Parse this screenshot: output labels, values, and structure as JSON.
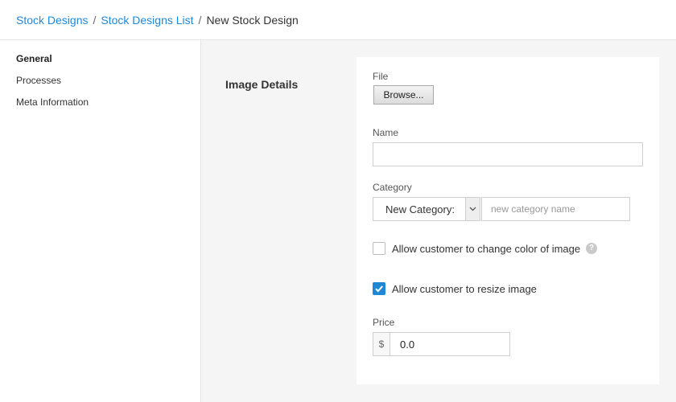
{
  "breadcrumb": {
    "items": [
      "Stock Designs",
      "Stock Designs List"
    ],
    "current": "New Stock Design",
    "separator": "/"
  },
  "sidebar": {
    "items": [
      {
        "label": "General",
        "active": true
      },
      {
        "label": "Processes",
        "active": false
      },
      {
        "label": "Meta Information",
        "active": false
      }
    ]
  },
  "section": {
    "title": "Image Details"
  },
  "form": {
    "file": {
      "label": "File",
      "button": "Browse..."
    },
    "name": {
      "label": "Name",
      "value": ""
    },
    "category": {
      "label": "Category",
      "selected": "New Category:",
      "placeholder": "new category name",
      "value": ""
    },
    "allow_color": {
      "label": "Allow customer to change color of image",
      "checked": false,
      "help_icon": "?"
    },
    "allow_resize": {
      "label": "Allow customer to resize image",
      "checked": true
    },
    "price": {
      "label": "Price",
      "currency": "$",
      "value": "0.0"
    }
  },
  "colors": {
    "accent": "#1e88d6",
    "main_bg": "#f5f5f5"
  }
}
